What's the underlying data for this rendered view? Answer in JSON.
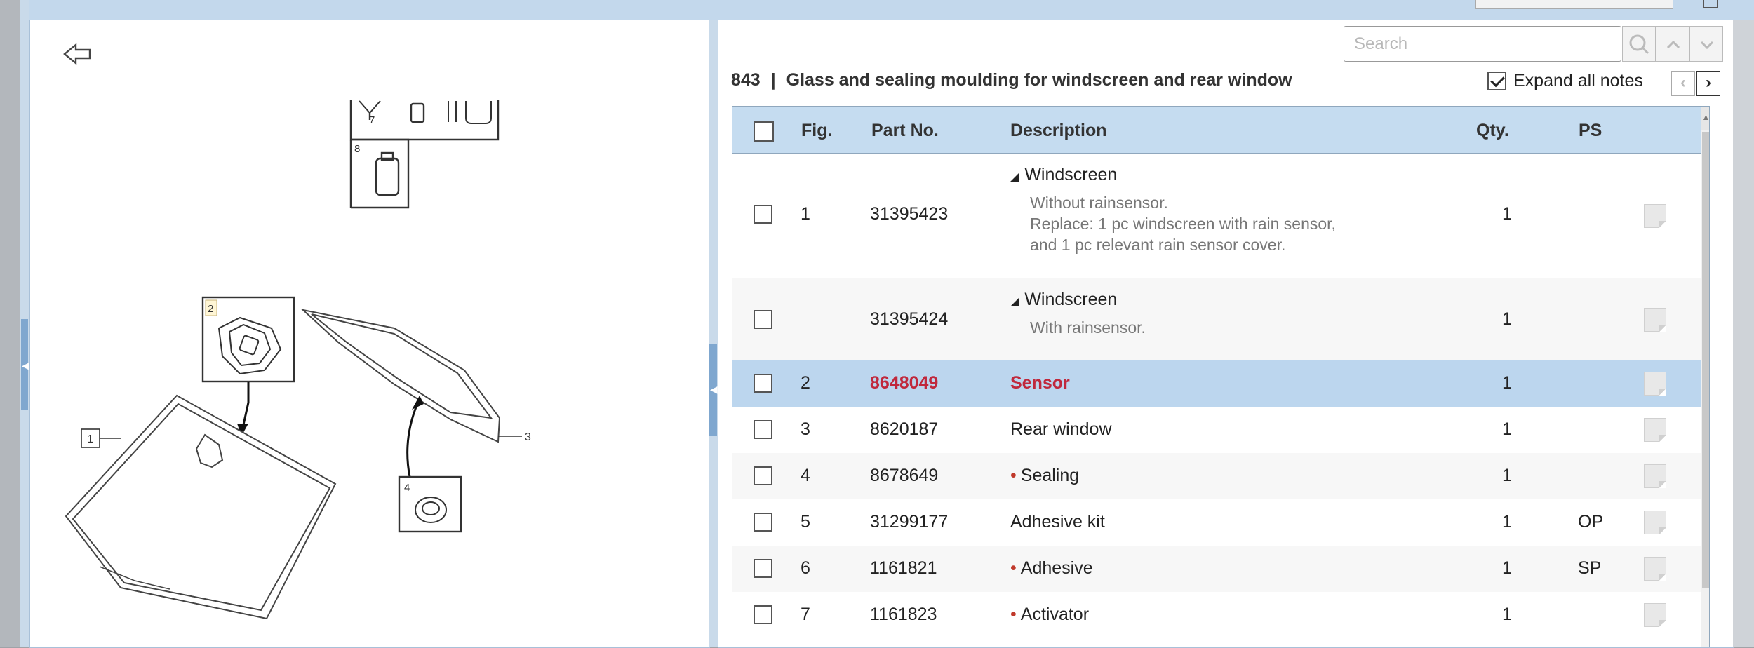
{
  "search": {
    "placeholder": "Search"
  },
  "page": {
    "group": "843",
    "separator": "|",
    "title": "Glass and sealing moulding for windscreen and rear window",
    "expand_label": "Expand all notes"
  },
  "table": {
    "headers": {
      "fig": "Fig.",
      "part_no": "Part No.",
      "description": "Description",
      "qty": "Qty.",
      "ps": "PS"
    },
    "rows": [
      {
        "fig": "1",
        "part_no": "31395423",
        "description": "Windscreen",
        "notes": [
          "Without rainsensor.",
          "Replace: 1 pc windscreen with rain sensor,",
          "and 1 pc relevant rain sensor cover."
        ],
        "qty": "1",
        "ps": ""
      },
      {
        "fig": "",
        "part_no": "31395424",
        "description": "Windscreen",
        "notes": [
          "With rainsensor."
        ],
        "qty": "1",
        "ps": ""
      },
      {
        "fig": "2",
        "part_no": "8648049",
        "description": "Sensor",
        "qty": "1",
        "ps": "",
        "selected": true
      },
      {
        "fig": "3",
        "part_no": "8620187",
        "description": "Rear window",
        "qty": "1",
        "ps": ""
      },
      {
        "fig": "4",
        "part_no": "8678649",
        "description": "Sealing",
        "qty": "1",
        "ps": "",
        "bullet": true
      },
      {
        "fig": "5",
        "part_no": "31299177",
        "description": "Adhesive kit",
        "qty": "1",
        "ps": "OP"
      },
      {
        "fig": "6",
        "part_no": "1161821",
        "description": "Adhesive",
        "qty": "1",
        "ps": "SP",
        "bullet": true
      },
      {
        "fig": "7",
        "part_no": "1161823",
        "description": "Activator",
        "qty": "1",
        "ps": "",
        "bullet": true
      }
    ]
  },
  "diagram": {
    "callouts": [
      "1",
      "2",
      "3",
      "4",
      "7",
      "8"
    ]
  },
  "colors": {
    "header_bg": "#c5dcf0",
    "selected_row": "#bcd6ee",
    "selected_text": "#c0283c",
    "alt_row": "#f7f7f7",
    "bullet": "#c0392b"
  },
  "icons": [
    "back-arrow-icon",
    "search-icon",
    "chevron-up-icon",
    "chevron-down-icon",
    "chevron-left-icon",
    "chevron-right-icon",
    "note-icon",
    "checkbox-icon"
  ]
}
